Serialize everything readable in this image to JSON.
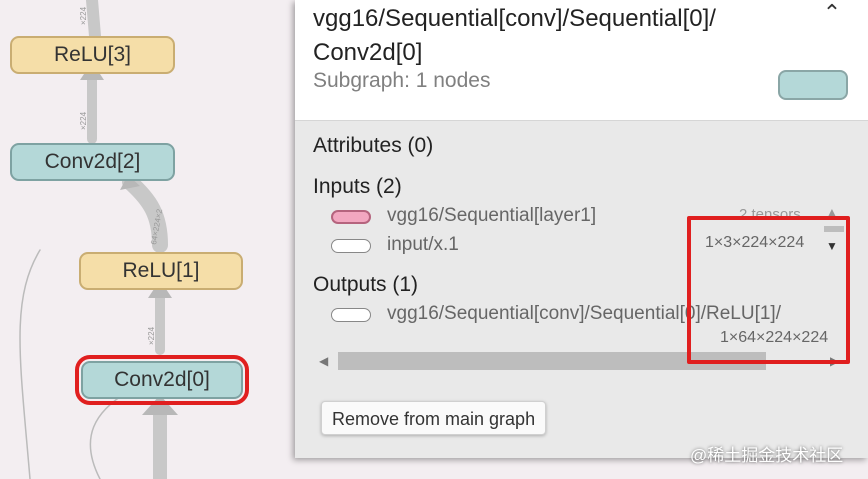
{
  "graph": {
    "nodes": [
      {
        "label": "ReLU[3]",
        "kind": "relu"
      },
      {
        "label": "Conv2d[2]",
        "kind": "conv"
      },
      {
        "label": "ReLU[1]",
        "kind": "relu"
      },
      {
        "label": "Conv2d[0]",
        "kind": "conv",
        "selected": true
      }
    ],
    "edge_labels": [
      "×224",
      "×224",
      "64×224×2",
      "×224"
    ]
  },
  "panel": {
    "title": "vgg16/Sequential[conv]/Sequential[0]/ Conv2d[0]",
    "subtitle": "Subgraph: 1 nodes",
    "collapse_icon": "chevron-up-icon",
    "swatch_color": "#b4d8d8",
    "attributes_heading": "Attributes (0)",
    "inputs_heading": "Inputs (2)",
    "inputs": [
      {
        "name": "vgg16/Sequential[layer1]",
        "shape": "2 tensors",
        "icon_color": "#f2a7c0"
      },
      {
        "name": "input/x.1",
        "shape": "1×3×224×224",
        "icon_color": "#ffffff"
      }
    ],
    "outputs_heading": "Outputs (1)",
    "outputs": [
      {
        "name": "vgg16/Sequential[conv]/Sequential[0]/ReLU[1]/",
        "shape": "1×64×224×224",
        "icon_color": "#ffffff"
      }
    ],
    "remove_button": "Remove from main graph"
  },
  "watermark": "@稀土掘金技术社区",
  "colors": {
    "highlight": "#e01f1f",
    "relu": "#f5dea8",
    "conv": "#b4d8d8"
  }
}
